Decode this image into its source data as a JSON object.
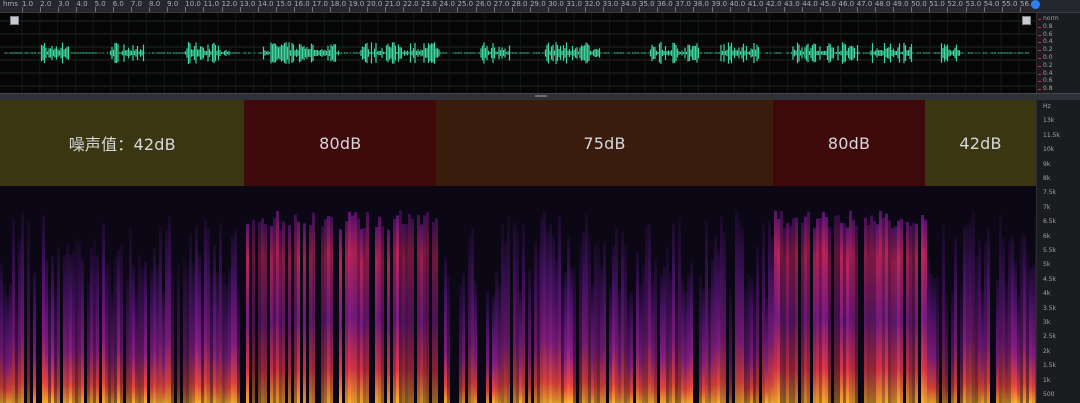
{
  "ruler": {
    "unit": "hms",
    "ticks": [
      "1.0",
      "2.0",
      "3.0",
      "4.0",
      "5.0",
      "6.0",
      "7.0",
      "8.0",
      "9.0",
      "10.0",
      "11.0",
      "12.0",
      "13.0",
      "14.0",
      "15.0",
      "16.0",
      "17.0",
      "18.0",
      "19.0",
      "20.0",
      "21.0",
      "22.0",
      "23.0",
      "24.0",
      "25.0",
      "26.0",
      "27.0",
      "28.0",
      "29.0",
      "30.0",
      "31.0",
      "32.0",
      "33.0",
      "34.0",
      "35.0",
      "36.0",
      "37.0",
      "38.0",
      "39.0",
      "40.0",
      "41.0",
      "42.0",
      "43.0",
      "44.0",
      "45.0",
      "46.0",
      "47.0",
      "48.0",
      "49.0",
      "50.0",
      "51.0",
      "52.0",
      "53.0",
      "54.0",
      "55.0",
      "56.0"
    ]
  },
  "waveform": {
    "scale_labels": [
      "norm",
      "0.8",
      "0.6",
      "0.4",
      "0.2",
      "0.0",
      "0.2",
      "0.4",
      "0.6",
      "0.8"
    ],
    "colors": {
      "wave": "#3fd6a0",
      "background": "#060607"
    }
  },
  "spectrogram": {
    "scale_labels": [
      "Hz",
      "13k",
      "11.5k",
      "10k",
      "9k",
      "8k",
      "7.5k",
      "7k",
      "6.5k",
      "6k",
      "5.5k",
      "5k",
      "4.5k",
      "4k",
      "3.5k",
      "3k",
      "2.5k",
      "2k",
      "1.5k",
      "1k",
      "500"
    ]
  },
  "noise_levels": [
    {
      "label": "噪声值：42dB",
      "start": 0.0,
      "end": 0.236,
      "color": "#3a3611"
    },
    {
      "label": "80dB",
      "start": 0.236,
      "end": 0.421,
      "color": "#3d090b"
    },
    {
      "label": "75dB",
      "start": 0.421,
      "end": 0.746,
      "color": "#3a1c0c"
    },
    {
      "label": "80dB",
      "start": 0.746,
      "end": 0.893,
      "color": "#3d090b"
    },
    {
      "label": "42dB",
      "start": 0.893,
      "end": 1.0,
      "color": "#3a3611"
    }
  ],
  "icons": [
    "expand-icon",
    "collapse-icon",
    "play-icon"
  ]
}
